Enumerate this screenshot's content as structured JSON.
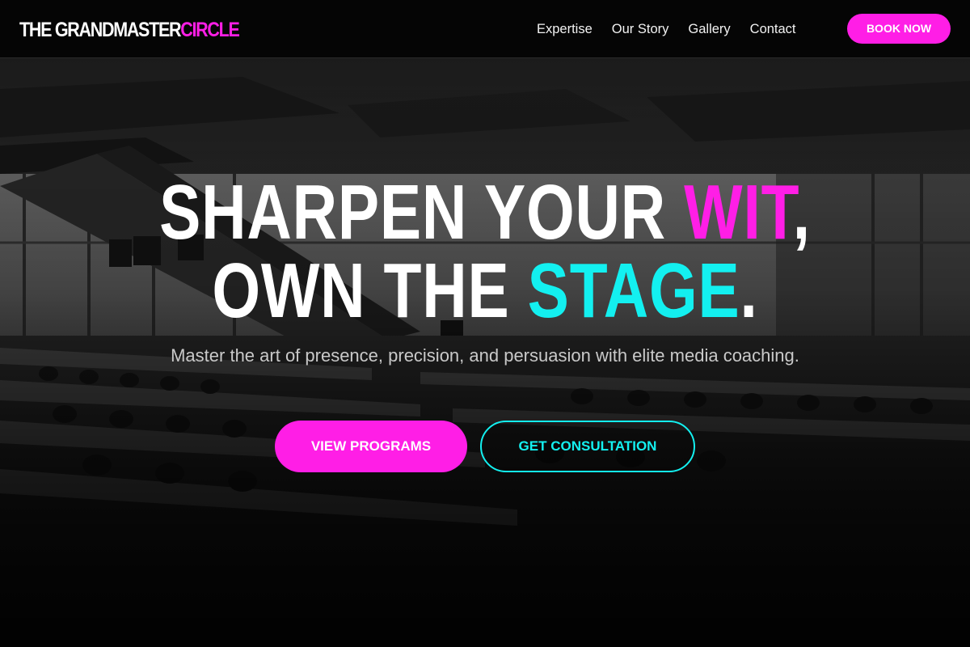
{
  "brand": {
    "name_main": "THE GRANDMASTER",
    "name_accent": "CIRCLE",
    "accent_color": "#ff1ee6"
  },
  "nav": {
    "links": [
      "Expertise",
      "Our Story",
      "Gallery",
      "Contact"
    ],
    "cta_label": "BOOK NOW"
  },
  "hero": {
    "headline_line1_part1": "SHARPEN YOUR ",
    "headline_line1_accent": "WIT",
    "headline_line1_end": ",",
    "headline_line2_part1": "OWN THE ",
    "headline_line2_accent": "STAGE",
    "headline_line2_end": ".",
    "subtitle": "Master the art of presence, precision, and persuasion with elite media coaching.",
    "primary_cta": "VIEW PROGRAMS",
    "secondary_cta": "GET CONSULTATION",
    "background_image": "dark-conference-hall-photo"
  },
  "colors": {
    "primary_pink": "#ff1ee6",
    "accent_cyan": "#13f0f0",
    "navbar_bg": "#050505"
  }
}
